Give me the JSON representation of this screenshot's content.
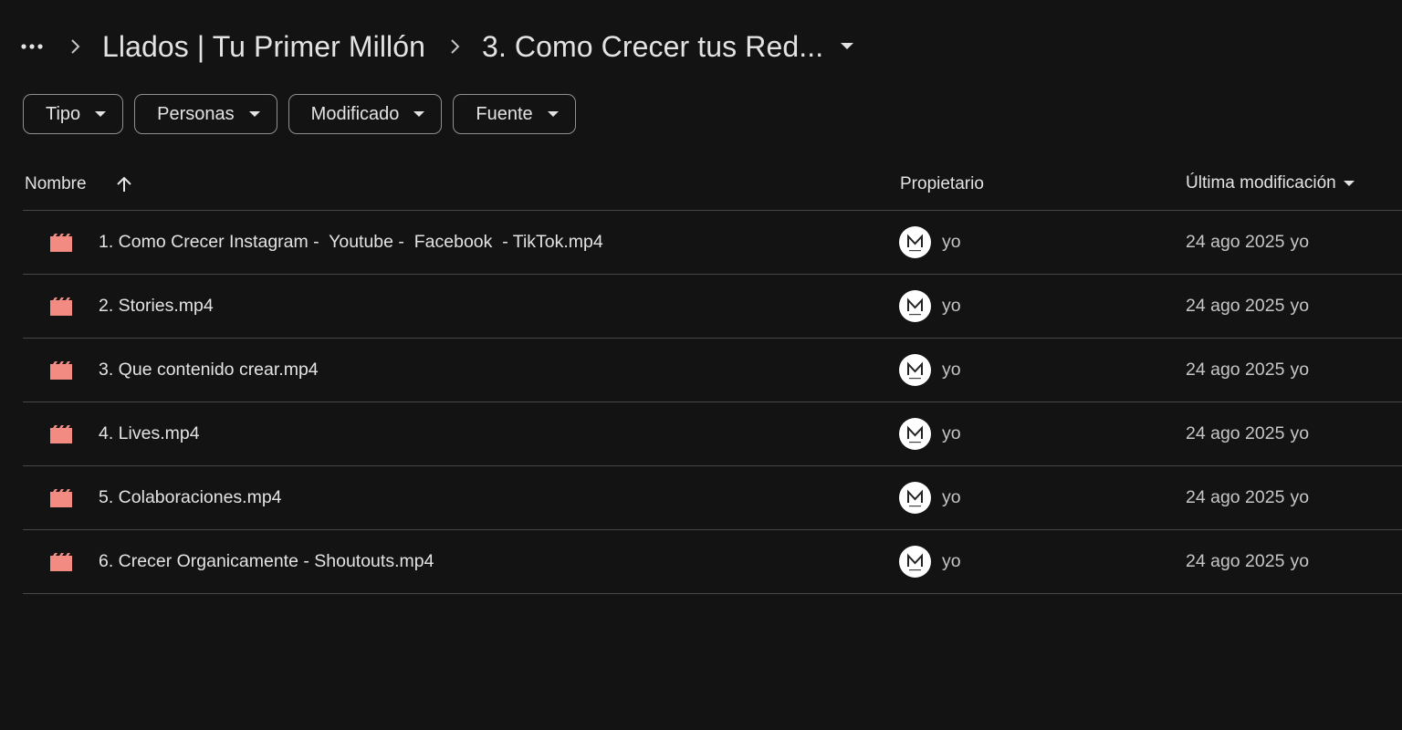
{
  "breadcrumb": {
    "more_label": "More",
    "parent": "Llados | Tu Primer Millón",
    "current": "3. Como Crecer tus Red..."
  },
  "filters": [
    {
      "label": "Tipo"
    },
    {
      "label": "Personas"
    },
    {
      "label": "Modificado"
    },
    {
      "label": "Fuente"
    }
  ],
  "columns": {
    "name": "Nombre",
    "owner": "Propietario",
    "modified": "Última modificación"
  },
  "icons": {
    "file": "video-file-icon",
    "file_color": "#f28b82",
    "avatar": "owner-avatar-logo"
  },
  "files": [
    {
      "name": "1. Como Crecer Instagram -  Youtube -  Facebook  - TikTok.mp4",
      "owner": "yo",
      "modified_date": "24 ago 2025",
      "modified_by": "yo"
    },
    {
      "name": "2. Stories.mp4",
      "owner": "yo",
      "modified_date": "24 ago 2025",
      "modified_by": "yo"
    },
    {
      "name": "3. Que contenido crear.mp4",
      "owner": "yo",
      "modified_date": "24 ago 2025",
      "modified_by": "yo"
    },
    {
      "name": "4. Lives.mp4",
      "owner": "yo",
      "modified_date": "24 ago 2025",
      "modified_by": "yo"
    },
    {
      "name": "5. Colaboraciones.mp4",
      "owner": "yo",
      "modified_date": "24 ago 2025",
      "modified_by": "yo"
    },
    {
      "name": "6. Crecer Organicamente - Shoutouts.mp4",
      "owner": "yo",
      "modified_date": "24 ago 2025",
      "modified_by": "yo"
    }
  ]
}
